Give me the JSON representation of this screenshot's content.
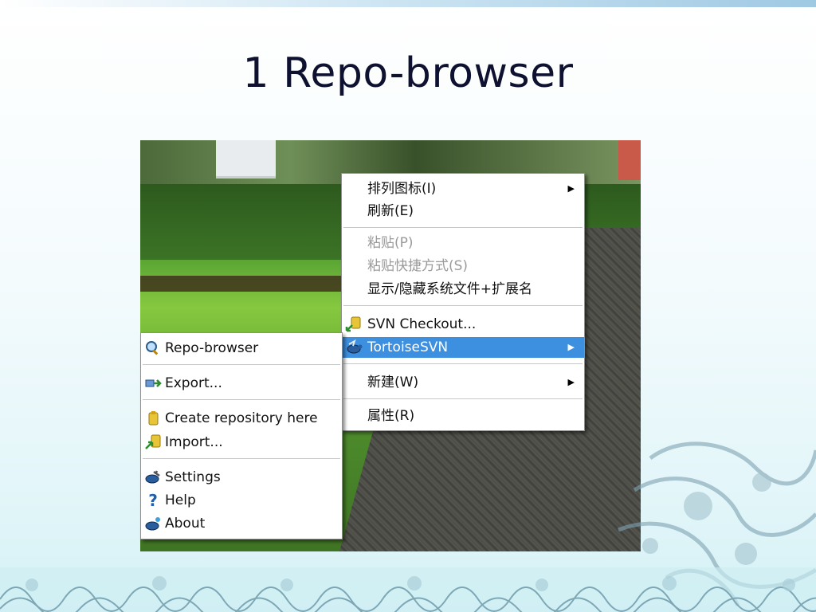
{
  "slide": {
    "title": "1 Repo-browser"
  },
  "context_menu": {
    "items": [
      {
        "label": "排列图标(I)",
        "submenu": true,
        "enabled": true
      },
      {
        "label": "刷新(E)",
        "enabled": true
      },
      {
        "label": "粘贴(P)",
        "enabled": false
      },
      {
        "label": "粘贴快捷方式(S)",
        "enabled": false
      },
      {
        "label": "显示/隐藏系统文件+扩展名",
        "enabled": true
      },
      {
        "label": "SVN Checkout...",
        "icon": "svn-checkout-icon",
        "enabled": true
      },
      {
        "label": "TortoiseSVN",
        "icon": "tortoisesvn-icon",
        "submenu": true,
        "highlighted": true,
        "enabled": true
      },
      {
        "label": "新建(W)",
        "submenu": true,
        "enabled": true
      },
      {
        "label": "属性(R)",
        "enabled": true
      }
    ]
  },
  "tortoisesvn_submenu": {
    "items": [
      {
        "label": "Repo-browser",
        "icon": "repo-browser-icon"
      },
      {
        "label": "Export...",
        "icon": "export-icon"
      },
      {
        "label": "Create repository here",
        "icon": "create-repository-icon"
      },
      {
        "label": "Import...",
        "icon": "import-icon"
      },
      {
        "label": "Settings",
        "icon": "settings-icon"
      },
      {
        "label": "Help",
        "icon": "help-icon"
      },
      {
        "label": "About",
        "icon": "about-icon"
      }
    ]
  },
  "colors": {
    "highlight": "#3d8fe0",
    "title": "#0e1230",
    "disabled_text": "#9a9a9a"
  }
}
